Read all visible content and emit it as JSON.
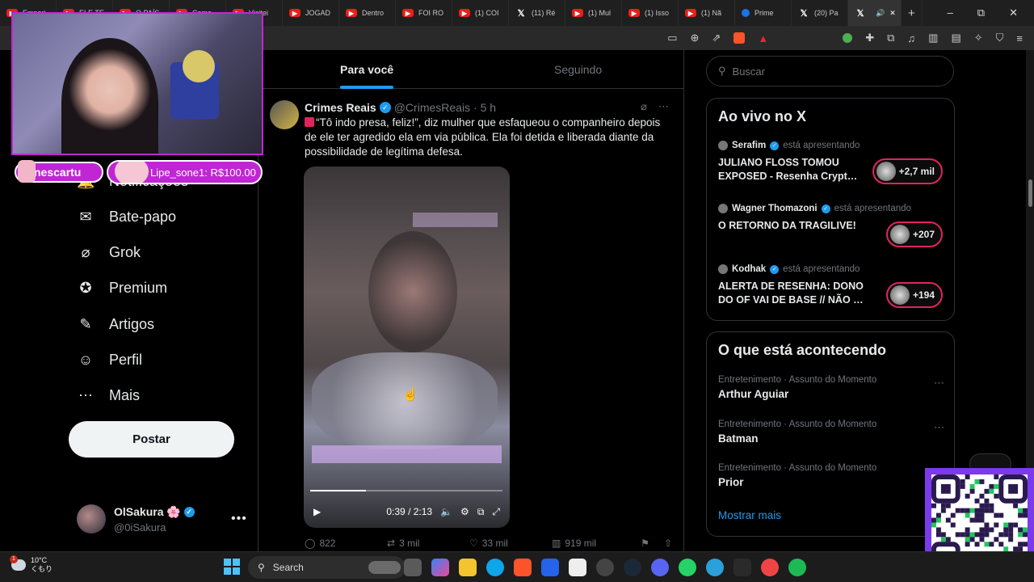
{
  "browser": {
    "tabs": [
      {
        "title": "Empari",
        "kind": "yt"
      },
      {
        "title": "ELE TE",
        "kind": "yt"
      },
      {
        "title": "O PAÍS",
        "kind": "yt"
      },
      {
        "title": "Como",
        "kind": "yt"
      },
      {
        "title": "Visitei",
        "kind": "yt"
      },
      {
        "title": "JOGAD",
        "kind": "yt"
      },
      {
        "title": "Dentro",
        "kind": "yt"
      },
      {
        "title": "FOI RO",
        "kind": "yt"
      },
      {
        "title": "(1) COI",
        "kind": "yt"
      },
      {
        "title": "(11) Ré",
        "kind": "x"
      },
      {
        "title": "(1) Mul",
        "kind": "yt"
      },
      {
        "title": "(1) Isso",
        "kind": "yt"
      },
      {
        "title": "(1) Nã",
        "kind": "yt"
      },
      {
        "title": "Prime",
        "kind": "pv"
      },
      {
        "title": "(20) Pa",
        "kind": "x"
      },
      {
        "title": "",
        "kind": "x-active"
      }
    ],
    "new_tab": "+",
    "window_controls": [
      "–",
      "⧉",
      "✕"
    ]
  },
  "sidebar": {
    "partial_item": "Notificações",
    "items": [
      {
        "label": "Bate-papo",
        "icon": "mail-icon",
        "glyph": "✉"
      },
      {
        "label": "Grok",
        "icon": "grok-icon",
        "glyph": "⌀"
      },
      {
        "label": "Premium",
        "icon": "premium-icon",
        "glyph": "✪"
      },
      {
        "label": "Artigos",
        "icon": "articles-icon",
        "glyph": "✎"
      },
      {
        "label": "Perfil",
        "icon": "person-icon",
        "glyph": "☺"
      },
      {
        "label": "Mais",
        "icon": "more-icon",
        "glyph": "⋯"
      }
    ],
    "post_button": "Postar",
    "profile": {
      "name": "OlSakura 🌸",
      "handle": "@0iSakura"
    }
  },
  "home": {
    "tabs": [
      "Para você",
      "Seguindo"
    ]
  },
  "tweet": {
    "author": "Crimes Reais",
    "handle": "@CrimesReais",
    "time": "· 5 h",
    "text": "“Tô indo presa, feliz!”, diz mulher que esfaqueou o companheiro depois de ele ter agredido ela em via pública. Ela foi detida e liberada diante da possibilidade de legítima defesa.",
    "video": {
      "time": "0:39 / 2:13",
      "progress": 0.29
    },
    "stats": {
      "replies": "822",
      "reposts": "3 mil",
      "likes": "33 mil",
      "views": "919 mil"
    }
  },
  "right": {
    "search_placeholder": "Buscar",
    "live": {
      "title": "Ao vivo no X",
      "items": [
        {
          "host": "Serafim",
          "status": "está apresentando",
          "title": "JULIANO FLOSS TOMOU EXPOSED - Resenha Crypt…",
          "count": "+2,7 mil"
        },
        {
          "host": "Wagner Thomazoni",
          "status": "está apresentando",
          "title": "O RETORNO DA TRAGILIVE!",
          "count": "+207"
        },
        {
          "host": "Kodhak",
          "status": "está apresentando",
          "title": "ALERTA DE RESENHA: DONO DO OF VAI DE BASE // NÃO …",
          "count": "+194"
        }
      ]
    },
    "trends": {
      "title": "O que está acontecendo",
      "items": [
        {
          "context": "Entretenimento · Assunto do Momento",
          "name": "Arthur Aguiar"
        },
        {
          "context": "Entretenimento · Assunto do Momento",
          "name": "Batman"
        },
        {
          "context": "Entretenimento · Assunto do Momento",
          "name": "Prior"
        }
      ],
      "show_more": "Mostrar mais"
    }
  },
  "overlay": {
    "alert1": "nescartu",
    "alert2": "Lipe_sone1: R$100.00"
  },
  "taskbar": {
    "temperature": "10°C",
    "weather_text": "くもり",
    "weather_badge": "1",
    "search": "Search"
  }
}
